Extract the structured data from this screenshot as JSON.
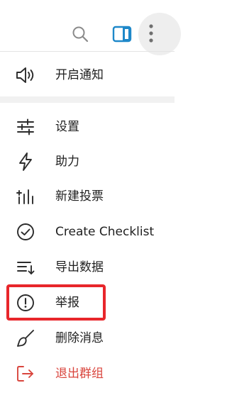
{
  "topbar": {
    "search_icon": "search-icon",
    "panel_icon": "sidebar-panel-icon",
    "more_icon": "more-vertical-icon",
    "accent_color": "#1e88c9"
  },
  "menu": {
    "items": [
      {
        "label": "开启通知",
        "icon": "speaker-icon"
      },
      {
        "label": "设置",
        "icon": "sliders-icon"
      },
      {
        "label": "助力",
        "icon": "lightning-icon"
      },
      {
        "label": "新建投票",
        "icon": "poll-icon"
      },
      {
        "label": "Create Checklist",
        "icon": "check-circle-icon"
      },
      {
        "label": "导出数据",
        "icon": "export-list-icon"
      },
      {
        "label": "举报",
        "icon": "alert-circle-icon"
      },
      {
        "label": "删除消息",
        "icon": "broom-icon"
      },
      {
        "label": "退出群组",
        "icon": "logout-icon"
      }
    ],
    "danger_color": "#d9453d",
    "highlight_color": "#e8262b"
  }
}
